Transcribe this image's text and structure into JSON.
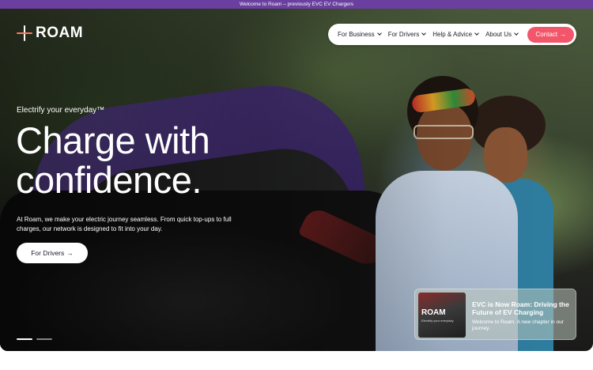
{
  "announcement": "Welcome to Roam – previously EVC EV Chargers",
  "brand": {
    "logo_text": "ROAM",
    "accent": "#f3566a",
    "banner_color": "#6b3fa0"
  },
  "nav": {
    "items": [
      {
        "label": "For Business"
      },
      {
        "label": "For Drivers"
      },
      {
        "label": "Help & Advice"
      },
      {
        "label": "About Us"
      }
    ],
    "contact_label": "Contact",
    "arrow": "→"
  },
  "hero": {
    "tagline": "Electrify your everyday™",
    "headline_line1": "Charge with",
    "headline_line2": "confidence.",
    "body": "At Roam, we make your electric journey seamless. From quick top-ups to full charges, our network is designed to fit into your day.",
    "cta_label": "For Drivers",
    "cta_arrow": "→"
  },
  "news_card": {
    "thumb_logo": "ROAM",
    "thumb_subtitle": "Electrify your everyday",
    "title": "EVC is Now Roam: Driving the Future of EV Charging",
    "description": "Welcome to Roam. A new chapter in our journey."
  }
}
